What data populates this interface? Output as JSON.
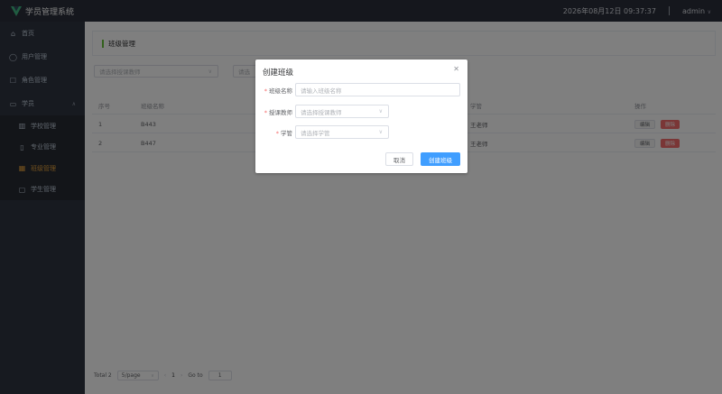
{
  "header": {
    "app_title": "学员管理系统",
    "datetime": "2026年08月12日 09:37:37",
    "user": "admin"
  },
  "sidebar": {
    "items": [
      {
        "label": "首页",
        "icon": "home-icon"
      },
      {
        "label": "用户管理",
        "icon": "user-icon"
      },
      {
        "label": "角色管理",
        "icon": "role-icon"
      },
      {
        "label": "学员",
        "icon": "student-icon"
      }
    ],
    "sub_items": [
      {
        "label": "学校管理",
        "icon": "school-icon"
      },
      {
        "label": "专业管理",
        "icon": "book-icon"
      },
      {
        "label": "班级管理",
        "icon": "grid-icon"
      },
      {
        "label": "学生管理",
        "icon": "doc-icon"
      }
    ]
  },
  "page": {
    "title": "班级管理",
    "filter_teacher_placeholder": "请选择授课教师",
    "filter_second_placeholder": "请选"
  },
  "table": {
    "headers": [
      "序号",
      "班级名称",
      "学管",
      "操作"
    ],
    "rows": [
      {
        "index": "1",
        "name": "B443",
        "manager": "王老师"
      },
      {
        "index": "2",
        "name": "B447",
        "manager": "王老师"
      }
    ],
    "edit_label": "编辑",
    "delete_label": "删除"
  },
  "pagination": {
    "total": "Total 2",
    "page_size": "5/page",
    "current_page": "1",
    "goto_label": "Go to",
    "goto_value": "1"
  },
  "dialog": {
    "title": "创建班级",
    "fields": [
      {
        "label": "班级名称",
        "placeholder": "请输入班级名称",
        "required": "*"
      },
      {
        "label": "授课教师",
        "placeholder": "请选择授课教师",
        "required": "*"
      },
      {
        "label": "学管",
        "placeholder": "请选择学管",
        "required": "*"
      }
    ],
    "cancel_label": "取消",
    "confirm_label": "创建班级"
  },
  "colors": {
    "header_bg": "#2b2f3a",
    "sidebar_bg": "#2f3440",
    "active": "#e6a23c",
    "primary": "#409eff",
    "danger": "#f56c6c",
    "accent_bar": "#67c23a"
  }
}
